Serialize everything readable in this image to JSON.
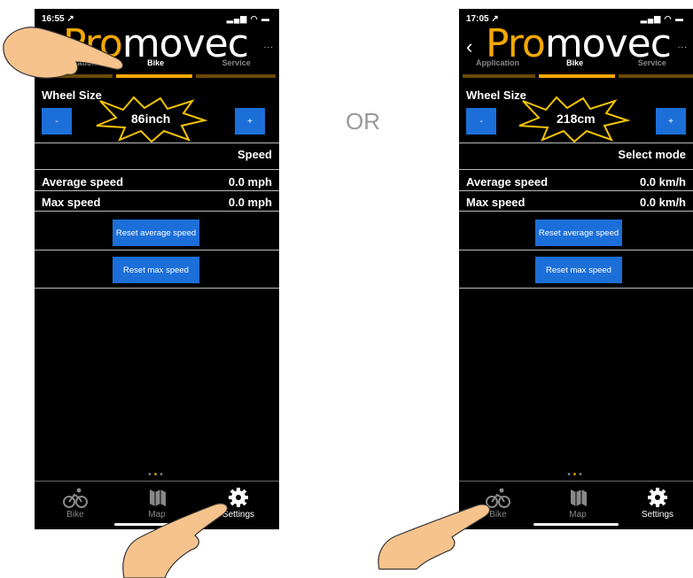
{
  "or_label": "OR",
  "colors": {
    "accent": "#f5a800",
    "button": "#1c6fd8",
    "background": "#000000"
  },
  "phones": [
    {
      "status_time": "16:55 ↗",
      "logo_brand": "Promovec",
      "menu_dots": "...",
      "tabs": [
        "Application",
        "Bike",
        "Service"
      ],
      "wheel_size_label": "Wheel Size",
      "minus_label": "-",
      "plus_label": "+",
      "wheel_value": "86inch",
      "speed_header": "Speed",
      "average_speed_label": "Average speed",
      "average_speed_value": "0.0 mph",
      "max_speed_label": "Max speed",
      "max_speed_value": "0.0 mph",
      "reset_average_label": "Reset average speed",
      "reset_max_label": "Reset max speed",
      "nav": [
        "Bike",
        "Map",
        "Settings"
      ]
    },
    {
      "status_time": "17:05 ↗",
      "logo_brand": "Promovec",
      "back_icon": "back-chevron",
      "menu_dots": "...",
      "tabs": [
        "Application",
        "Bike",
        "Service"
      ],
      "wheel_size_label": "Wheel Size",
      "minus_label": "-",
      "plus_label": "+",
      "wheel_value": "218cm",
      "speed_header": "Select mode",
      "average_speed_label": "Average speed",
      "average_speed_value": "0.0 km/h",
      "max_speed_label": "Max speed",
      "max_speed_value": "0.0 km/h",
      "reset_average_label": "Reset average speed",
      "reset_max_label": "Reset max speed",
      "nav": [
        "Bike",
        "Map",
        "Settings"
      ]
    }
  ]
}
